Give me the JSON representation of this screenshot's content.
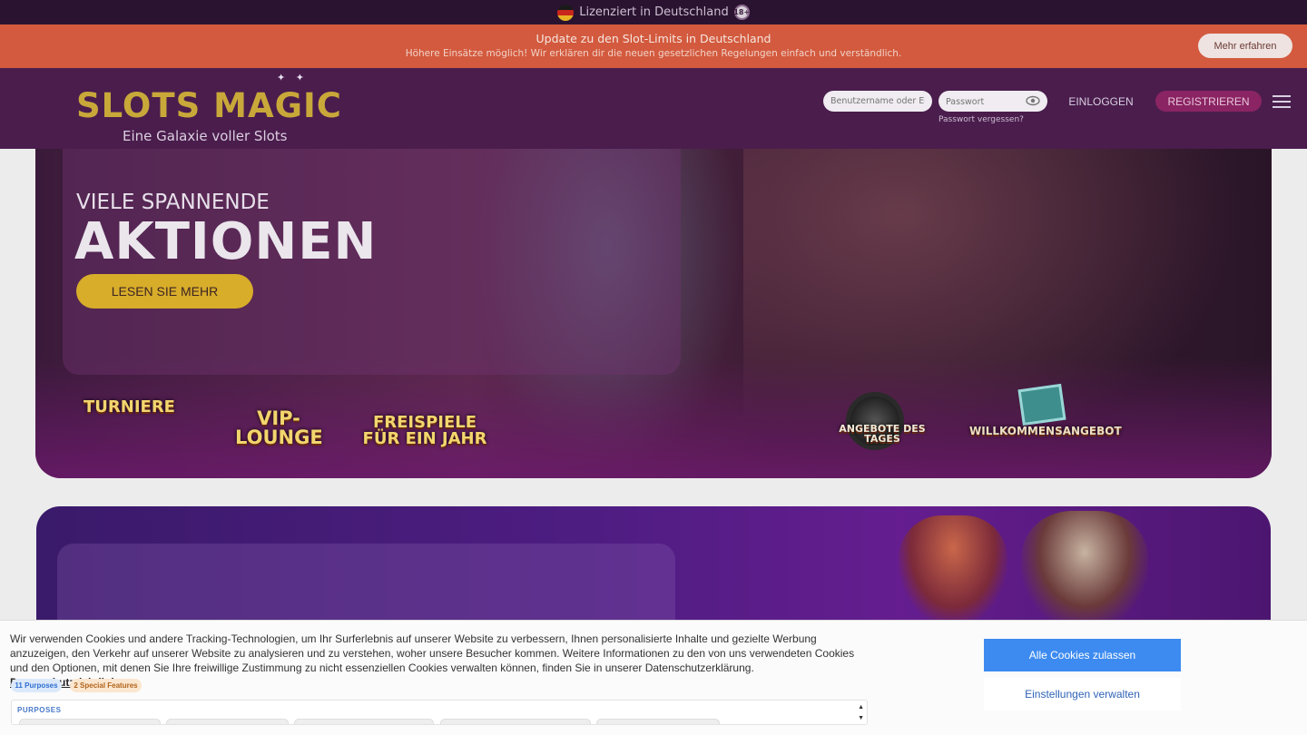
{
  "license_bar": {
    "text": "Lizenziert in Deutschland",
    "age": "18+",
    "flag_icon": "germany-flag-icon"
  },
  "update_banner": {
    "title": "Update zu den Slot-Limits in Deutschland",
    "subtitle": "Höhere Einsätze möglich! Wir erklären dir die neuen gesetzlichen Regelungen einfach und verständlich.",
    "button": "Mehr erfahren"
  },
  "header": {
    "logo": "SLOTS MAGIC",
    "tagline": "Eine Galaxie voller Slots",
    "username_placeholder": "Benutzername oder E-Mail",
    "password_placeholder": "Passwort",
    "forgot_password": "Passwort vergessen?",
    "login": "EINLOGGEN",
    "register": "REGISTRIEREN"
  },
  "hero": {
    "subtitle": "VIELE SPANNENDE",
    "title": "AKTIONEN",
    "button": "LESEN SIE MEHR",
    "promos": [
      "TURNIERE",
      "VIP-LOUNGE",
      "FREISPIELE FÜR EIN JAHR",
      "ANGEBOTE DES TAGES",
      "WILLKOMMENSANGEBOT"
    ]
  },
  "cookie": {
    "text": "Wir verwenden Cookies und andere Tracking-Technologien, um Ihr Surferlebnis auf unserer Website zu verbessern, Ihnen personalisierte Inhalte und gezielte Werbung anzuzeigen, den Verkehr auf unserer Website zu analysieren und zu verstehen, woher unsere Besucher kommen. Weitere Informationen zu den von uns verwendeten Cookies und den Optionen, mit denen Sie Ihre freiwillige Zustimmung zu nicht essenziellen Cookies verwalten können, finden Sie in unserer Datenschutzerklärung.",
    "link": "Datenschutzrichtlinie zu",
    "purposes_tag": "11 Purposes",
    "special_tag": "2 Special Features",
    "purposes_label": "PURPOSES",
    "accept_all": "Alle Cookies zulassen",
    "manage_settings": "Einstellungen verwalten"
  },
  "colors": {
    "license_bg": "#2a1330",
    "banner_bg": "#d35a3e",
    "header_bg": "#4a1d4d",
    "register_bg": "#8a2462",
    "gold": "#d7ad2a",
    "accept_blue": "#3d8bf0"
  }
}
